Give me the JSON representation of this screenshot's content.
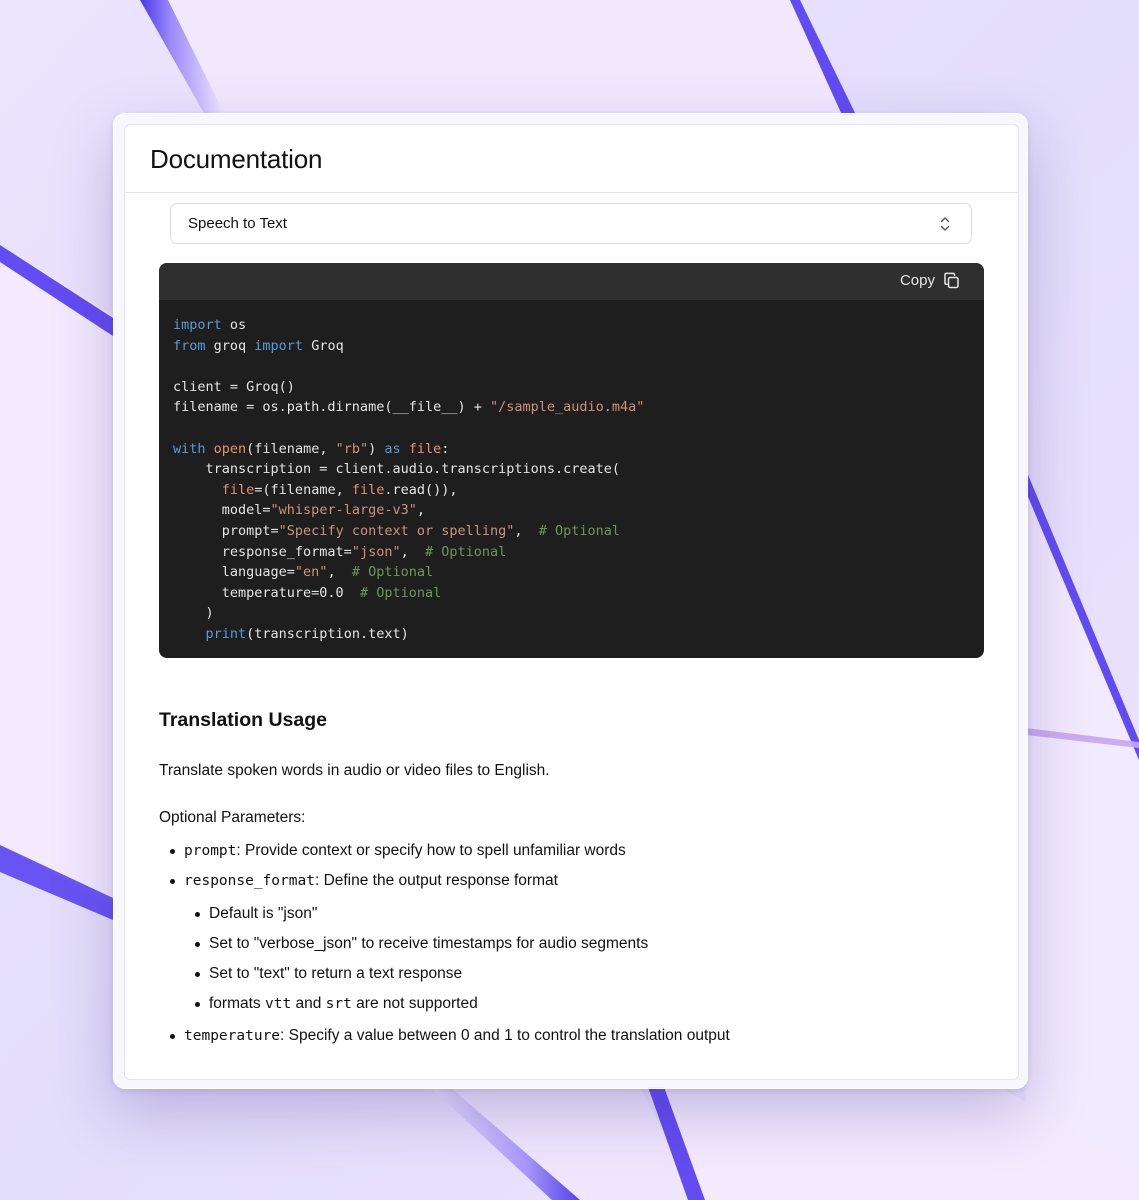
{
  "panel": {
    "title": "Documentation"
  },
  "selector": {
    "value": "Speech to Text",
    "icon": "chevron-up-down-icon"
  },
  "code_block": {
    "copy_label": "Copy",
    "copy_icon": "copy-icon",
    "language": "python",
    "lines": [
      [
        {
          "t": "kw",
          "v": "import"
        },
        {
          "t": "txt",
          "v": " os"
        }
      ],
      [
        {
          "t": "kw",
          "v": "from"
        },
        {
          "t": "txt",
          "v": " groq "
        },
        {
          "t": "kw",
          "v": "import"
        },
        {
          "t": "txt",
          "v": " Groq"
        }
      ],
      [],
      [
        {
          "t": "txt",
          "v": "client = Groq()"
        }
      ],
      [
        {
          "t": "txt",
          "v": "filename = os.path.dirname(__file__) + "
        },
        {
          "t": "str",
          "v": "\"/sample_audio.m4a\""
        }
      ],
      [],
      [
        {
          "t": "kw",
          "v": "with"
        },
        {
          "t": "txt",
          "v": " "
        },
        {
          "t": "param",
          "v": "open"
        },
        {
          "t": "txt",
          "v": "(filename, "
        },
        {
          "t": "str",
          "v": "\"rb\""
        },
        {
          "t": "txt",
          "v": ") "
        },
        {
          "t": "kw",
          "v": "as"
        },
        {
          "t": "txt",
          "v": " "
        },
        {
          "t": "param",
          "v": "file"
        },
        {
          "t": "txt",
          "v": ":"
        }
      ],
      [
        {
          "t": "txt",
          "v": "    transcription = client.audio.transcriptions.create("
        }
      ],
      [
        {
          "t": "txt",
          "v": "      "
        },
        {
          "t": "param",
          "v": "file"
        },
        {
          "t": "txt",
          "v": "=(filename, "
        },
        {
          "t": "param",
          "v": "file"
        },
        {
          "t": "txt",
          "v": ".read()),"
        }
      ],
      [
        {
          "t": "txt",
          "v": "      model="
        },
        {
          "t": "str",
          "v": "\"whisper-large-v3\""
        },
        {
          "t": "txt",
          "v": ","
        }
      ],
      [
        {
          "t": "txt",
          "v": "      prompt="
        },
        {
          "t": "str",
          "v": "\"Specify context or spelling\""
        },
        {
          "t": "txt",
          "v": ",  "
        },
        {
          "t": "cmt",
          "v": "# Optional"
        }
      ],
      [
        {
          "t": "txt",
          "v": "      response_format="
        },
        {
          "t": "str",
          "v": "\"json\""
        },
        {
          "t": "txt",
          "v": ",  "
        },
        {
          "t": "cmt",
          "v": "# Optional"
        }
      ],
      [
        {
          "t": "txt",
          "v": "      language="
        },
        {
          "t": "str",
          "v": "\"en\""
        },
        {
          "t": "txt",
          "v": ",  "
        },
        {
          "t": "cmt",
          "v": "# Optional"
        }
      ],
      [
        {
          "t": "txt",
          "v": "      temperature=0.0  "
        },
        {
          "t": "cmt",
          "v": "# Optional"
        }
      ],
      [
        {
          "t": "txt",
          "v": "    )"
        }
      ],
      [
        {
          "t": "txt",
          "v": "    "
        },
        {
          "t": "kw",
          "v": "print"
        },
        {
          "t": "txt",
          "v": "(transcription.text)"
        }
      ]
    ]
  },
  "translation": {
    "heading": "Translation Usage",
    "description": "Translate spoken words in audio or video files to English.",
    "params_label": "Optional Parameters:",
    "params": {
      "prompt": {
        "code": "prompt",
        "text": ": Provide context or specify how to spell unfamiliar words"
      },
      "response_format": {
        "code": "response_format",
        "text": ": Define the output response format",
        "sub": {
          "default": "Default is \"json\"",
          "verbose": "Set to \"verbose_json\" to receive timestamps for audio segments",
          "text_resp": "Set to \"text\" to return a text response",
          "formats_prefix": "formats ",
          "formats_vtt": "vtt",
          "formats_and": " and ",
          "formats_srt": "srt",
          "formats_suffix": " are not supported"
        }
      },
      "temperature": {
        "code": "temperature",
        "text": ": Specify a value between 0 and 1 to control the translation output"
      }
    }
  },
  "colors": {
    "code_bg": "#1e1e1e",
    "code_toolbar": "#2f2f2f",
    "keyword": "#569cd6",
    "string": "#ce9178",
    "comment": "#6a9955",
    "background_accent": "#5b3df0"
  }
}
